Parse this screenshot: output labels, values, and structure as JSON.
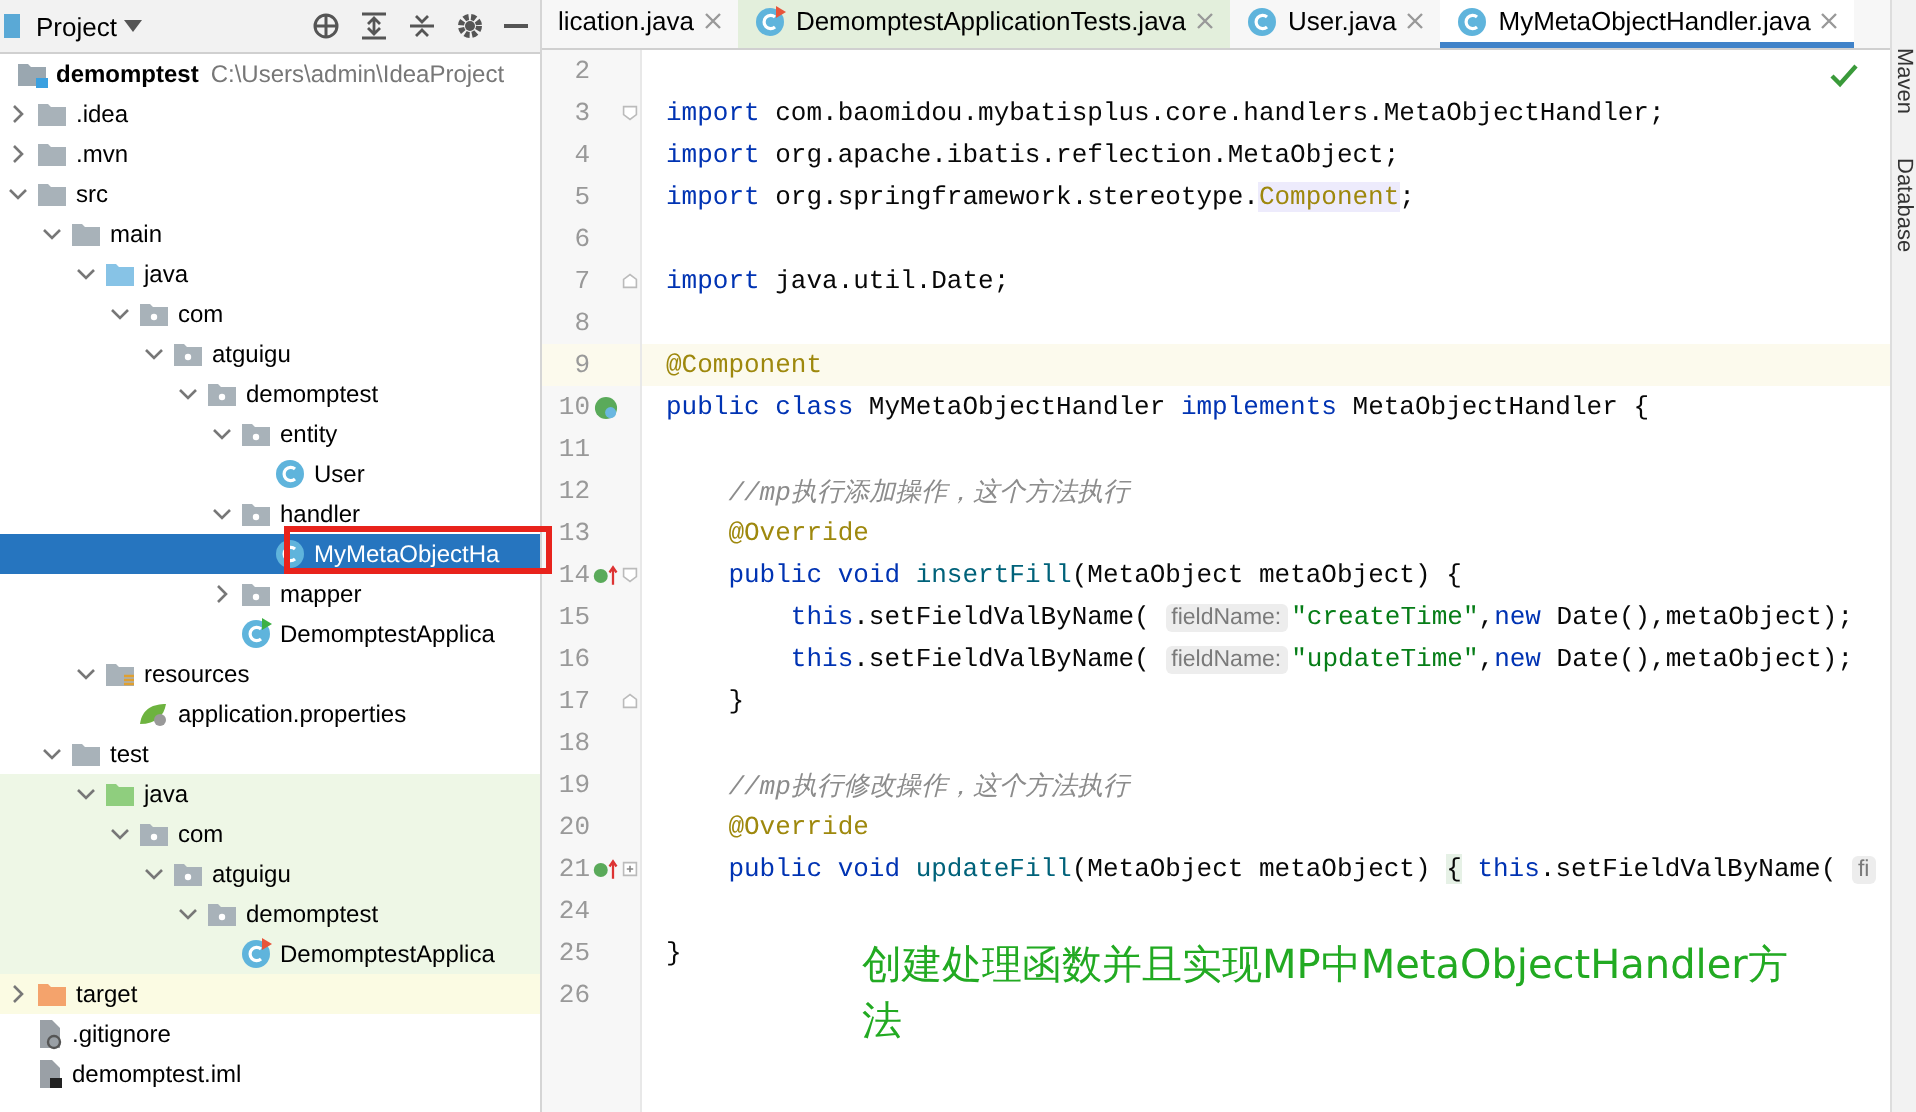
{
  "project_panel": {
    "title": "Project",
    "tree": [
      {
        "label": "demomptest",
        "path": "C:\\Users\\admin\\IdeaProject",
        "kind": "project",
        "selected": false,
        "children": [
          {
            "label": ".idea",
            "kind": "folder",
            "expanded": false,
            "selected": false
          },
          {
            "label": ".mvn",
            "kind": "folder",
            "expanded": false,
            "selected": false
          },
          {
            "label": "src",
            "kind": "folder",
            "expanded": true,
            "selected": false,
            "children": [
              {
                "label": "main",
                "kind": "folder",
                "expanded": true,
                "selected": false,
                "children": [
                  {
                    "label": "java",
                    "kind": "source",
                    "expanded": true,
                    "selected": false,
                    "children": [
                      {
                        "label": "com",
                        "kind": "package",
                        "expanded": true,
                        "selected": false,
                        "children": [
                          {
                            "label": "atguigu",
                            "kind": "package",
                            "expanded": true,
                            "selected": false,
                            "children": [
                              {
                                "label": "demomptest",
                                "kind": "package",
                                "expanded": true,
                                "selected": false,
                                "children": [
                                  {
                                    "label": "entity",
                                    "kind": "package",
                                    "expanded": true,
                                    "selected": false,
                                    "children": [
                                      {
                                        "label": "User",
                                        "kind": "class",
                                        "selected": false
                                      }
                                    ]
                                  },
                                  {
                                    "label": "handler",
                                    "kind": "package",
                                    "expanded": true,
                                    "selected": false,
                                    "children": [
                                      {
                                        "label": "MyMetaObjectHa",
                                        "kind": "class",
                                        "selected": true
                                      }
                                    ]
                                  },
                                  {
                                    "label": "mapper",
                                    "kind": "package",
                                    "expanded": false,
                                    "selected": false
                                  },
                                  {
                                    "label": "DemomptestApplica",
                                    "kind": "app",
                                    "selected": false
                                  }
                                ]
                              }
                            ]
                          }
                        ]
                      }
                    ]
                  },
                  {
                    "label": "resources",
                    "kind": "resources",
                    "expanded": true,
                    "selected": false,
                    "children": [
                      {
                        "label": "application.properties",
                        "kind": "properties",
                        "selected": false
                      }
                    ]
                  }
                ]
              },
              {
                "label": "test",
                "kind": "folder",
                "expanded": true,
                "selected": false,
                "children": [
                  {
                    "label": "java",
                    "kind": "test",
                    "expanded": true,
                    "selected": false,
                    "children": [
                      {
                        "label": "com",
                        "kind": "package",
                        "expanded": true,
                        "selected": false,
                        "children": [
                          {
                            "label": "atguigu",
                            "kind": "package",
                            "expanded": true,
                            "selected": false,
                            "children": [
                              {
                                "label": "demomptest",
                                "kind": "package",
                                "expanded": true,
                                "selected": false,
                                "children": [
                                  {
                                    "label": "DemomptestApplica",
                                    "kind": "testclass",
                                    "selected": false
                                  }
                                ]
                              }
                            ]
                          }
                        ]
                      }
                    ]
                  }
                ]
              }
            ]
          },
          {
            "label": "target",
            "kind": "excluded",
            "expanded": false,
            "selected": false
          },
          {
            "label": ".gitignore",
            "kind": "gitignore",
            "selected": false
          },
          {
            "label": "demomptest.iml",
            "kind": "iml",
            "selected": false
          }
        ]
      }
    ]
  },
  "tabs": [
    {
      "label": "lication.java",
      "kind": "partial",
      "selected": false
    },
    {
      "label": "DemomptestApplicationTests.java",
      "kind": "testclass",
      "selected": false
    },
    {
      "label": "User.java",
      "kind": "class",
      "selected": false
    },
    {
      "label": "MyMetaObjectHandler.java",
      "kind": "class",
      "selected": true
    }
  ],
  "editor": {
    "lines": [
      {
        "number": "2"
      },
      {
        "number": "3",
        "fold_marker": {
          "kind": "start"
        },
        "tokens": [
          {
            "kind": "kw",
            "text": "import"
          },
          {
            "kind": "plain",
            "text": " com.baomidou.mybatisplus.core.handlers.MetaObjectHandler;"
          }
        ]
      },
      {
        "number": "4",
        "tokens": [
          {
            "kind": "kw",
            "text": "import"
          },
          {
            "kind": "plain",
            "text": " org.apache.ibatis.reflection.MetaObject;"
          }
        ]
      },
      {
        "number": "5",
        "tokens": [
          {
            "kind": "kw",
            "text": "import"
          },
          {
            "kind": "plain",
            "text": " org.springframework.stereotype."
          },
          {
            "kind": "ref",
            "text": "Component"
          },
          {
            "kind": "plain",
            "text": ";"
          }
        ]
      },
      {
        "number": "6"
      },
      {
        "number": "7",
        "fold_marker": {
          "kind": "end"
        },
        "tokens": [
          {
            "kind": "kw",
            "text": "import"
          },
          {
            "kind": "plain",
            "text": " java.util.Date;"
          }
        ]
      },
      {
        "number": "8"
      },
      {
        "number": "9",
        "current": true,
        "tokens": [
          {
            "kind": "ann",
            "text": "@Component"
          }
        ]
      },
      {
        "number": "10",
        "gutter_icon": {
          "kind": "bean"
        },
        "tokens": [
          {
            "kind": "kw",
            "text": "public class"
          },
          {
            "kind": "plain",
            "text": " MyMetaObjectHandler "
          },
          {
            "kind": "kw",
            "text": "implements"
          },
          {
            "kind": "plain",
            "text": " MetaObjectHandler {"
          }
        ]
      },
      {
        "number": "11"
      },
      {
        "number": "12",
        "tokens": [
          {
            "kind": "comment",
            "text": "    //mp执行添加操作，这个方法执行"
          }
        ]
      },
      {
        "number": "13",
        "tokens": [
          {
            "kind": "ann",
            "text": "    @Override"
          }
        ]
      },
      {
        "number": "14",
        "gutter_icon": {
          "kind": "implements"
        },
        "fold_marker": {
          "kind": "start"
        },
        "tokens": [
          {
            "kind": "kw",
            "text": "    public void"
          },
          {
            "kind": "method",
            "text": " insertFill"
          },
          {
            "kind": "plain",
            "text": "(MetaObject metaObject) {"
          }
        ]
      },
      {
        "number": "15",
        "tokens": [
          {
            "kind": "kw",
            "text": "        this"
          },
          {
            "kind": "plain",
            "text": ".setFieldValByName( "
          },
          {
            "kind": "hint",
            "text": "fieldName:"
          },
          {
            "kind": "str",
            "text": "\"createTime\""
          },
          {
            "kind": "plain",
            "text": ","
          },
          {
            "kind": "kw",
            "text": "new"
          },
          {
            "kind": "plain",
            "text": " Date(),metaObject);"
          }
        ]
      },
      {
        "number": "16",
        "tokens": [
          {
            "kind": "kw",
            "text": "        this"
          },
          {
            "kind": "plain",
            "text": ".setFieldValByName( "
          },
          {
            "kind": "hint",
            "text": "fieldName:"
          },
          {
            "kind": "str",
            "text": "\"updateTime\""
          },
          {
            "kind": "plain",
            "text": ","
          },
          {
            "kind": "kw",
            "text": "new"
          },
          {
            "kind": "plain",
            "text": " Date(),metaObject);"
          }
        ]
      },
      {
        "number": "17",
        "fold_marker": {
          "kind": "end"
        },
        "tokens": [
          {
            "kind": "plain",
            "text": "    }"
          }
        ]
      },
      {
        "number": "18"
      },
      {
        "number": "19",
        "tokens": [
          {
            "kind": "comment",
            "text": "    //mp执行修改操作，这个方法执行"
          }
        ]
      },
      {
        "number": "20",
        "tokens": [
          {
            "kind": "ann",
            "text": "    @Override"
          }
        ]
      },
      {
        "number": "21",
        "gutter_icon": {
          "kind": "implements"
        },
        "fold_marker": {
          "kind": "collapsed"
        },
        "tokens": [
          {
            "kind": "kw",
            "text": "    public void"
          },
          {
            "kind": "method",
            "text": " updateFill"
          },
          {
            "kind": "plain",
            "text": "(MetaObject metaObject) "
          },
          {
            "kind": "brace",
            "text": "{"
          },
          {
            "kind": "kw",
            "text": " this"
          },
          {
            "kind": "plain",
            "text": ".setFieldValByName( "
          },
          {
            "kind": "hint",
            "text": "fi"
          }
        ]
      },
      {
        "number": "24"
      },
      {
        "number": "25",
        "tokens": [
          {
            "kind": "plain",
            "text": "}"
          }
        ]
      },
      {
        "number": "26"
      }
    ],
    "note": "创建处理函数并且实现MP中MetaObjectHandler方法"
  },
  "tool_windows": [
    "Maven",
    "Database"
  ]
}
